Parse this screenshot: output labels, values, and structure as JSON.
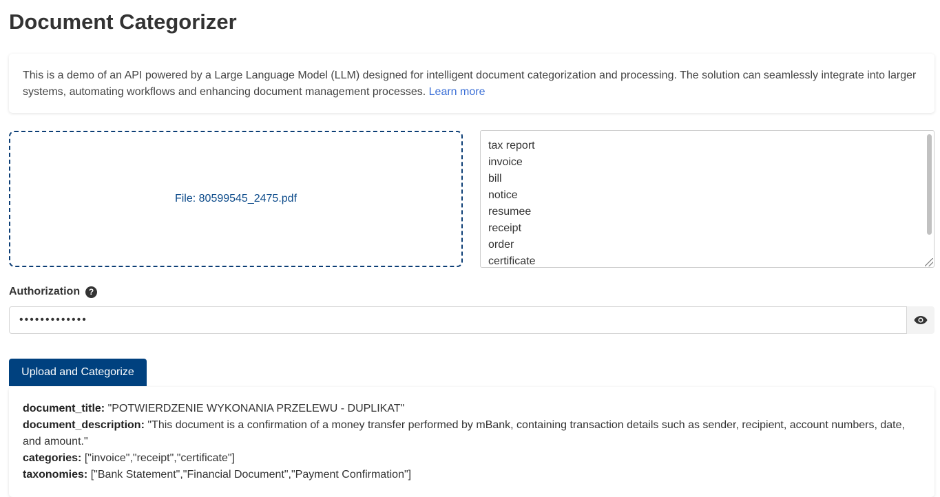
{
  "title": "Document Categorizer",
  "intro": {
    "text": "This is a demo of an API powered by a Large Language Model (LLM) designed for intelligent document categorization and processing. The solution can seamlessly integrate into larger systems, automating workflows and enhancing document management processes.",
    "link": "Learn more"
  },
  "dropzone": {
    "label": "File: 80599545_2475.pdf"
  },
  "categories": [
    "tax report",
    "invoice",
    "bill",
    "notice",
    "resumee",
    "receipt",
    "order",
    "certificate"
  ],
  "auth": {
    "label": "Authorization",
    "help": "?",
    "value": "•••••••••••••"
  },
  "button": {
    "label": "Upload and Categorize"
  },
  "result": [
    {
      "key": "document_title:",
      "value": "\"POTWIERDZENIE WYKONANIA PRZELEWU - DUPLIKAT\""
    },
    {
      "key": "document_description:",
      "value": "\"This document is a confirmation of a money transfer performed by mBank, containing transaction details such as sender, recipient, account numbers, date, and amount.\""
    },
    {
      "key": "categories:",
      "value": "[\"invoice\",\"receipt\",\"certificate\"]"
    },
    {
      "key": "taxonomies:",
      "value": "[\"Bank Statement\",\"Financial Document\",\"Payment Confirmation\"]"
    }
  ]
}
